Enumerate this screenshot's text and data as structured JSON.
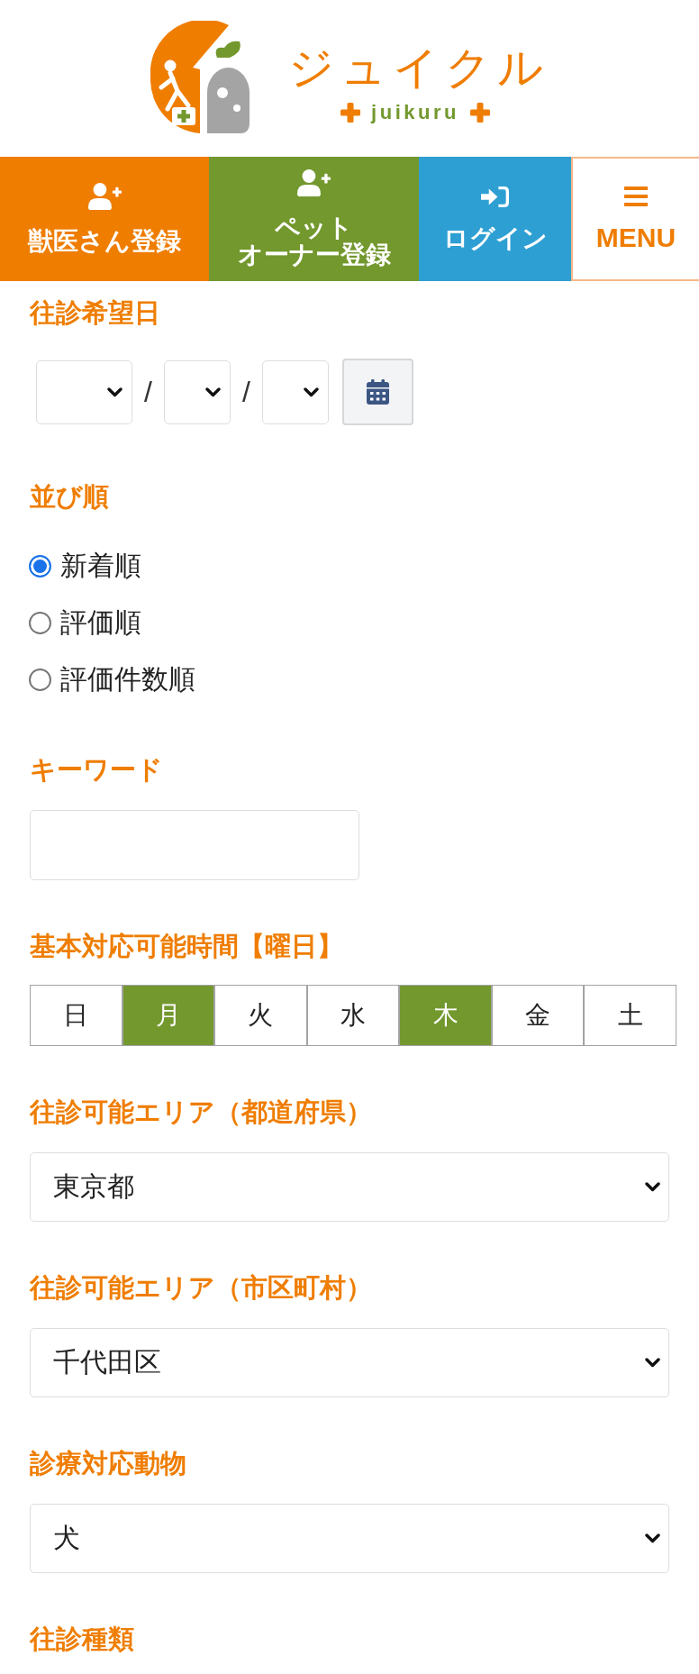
{
  "header": {
    "logo": {
      "title": "ジュイクル",
      "subtitle": "juikuru"
    }
  },
  "nav": [
    {
      "kind": "register",
      "lines": [
        "獣医さん登録"
      ],
      "color": "#ef7d00"
    },
    {
      "kind": "register",
      "lines": [
        "ペット",
        "オーナー登録"
      ],
      "color": "#73982e"
    },
    {
      "kind": "login",
      "lines": [
        "ログイン"
      ],
      "color": "#2e9fd3"
    },
    {
      "kind": "menu",
      "lines": [
        "MENU"
      ],
      "color": "#ffffff"
    }
  ],
  "form": [
    {
      "kind": "date",
      "label": "往診希望日",
      "separators": [
        "/",
        "/"
      ]
    },
    {
      "kind": "radio",
      "label": "並び順",
      "options": [
        {
          "label": "新着順",
          "selected": true
        },
        {
          "label": "評価順",
          "selected": false
        },
        {
          "label": "評価件数順",
          "selected": false
        }
      ]
    },
    {
      "kind": "text",
      "label": "キーワード"
    },
    {
      "kind": "toggles",
      "label": "基本対応可能時間【曜日】",
      "options": [
        {
          "label": "日",
          "selected": false
        },
        {
          "label": "月",
          "selected": true
        },
        {
          "label": "火",
          "selected": false
        },
        {
          "label": "水",
          "selected": false
        },
        {
          "label": "木",
          "selected": true
        },
        {
          "label": "金",
          "selected": false
        },
        {
          "label": "土",
          "selected": false
        }
      ]
    },
    {
      "kind": "select",
      "label": "往診可能エリア（都道府県）",
      "value": "東京都"
    },
    {
      "kind": "select",
      "label": "往診可能エリア（市区町村）",
      "value": "千代田区"
    },
    {
      "kind": "select",
      "label": "診療対応動物",
      "value": "犬"
    },
    {
      "kind": "heading",
      "label": "往診種類"
    }
  ]
}
